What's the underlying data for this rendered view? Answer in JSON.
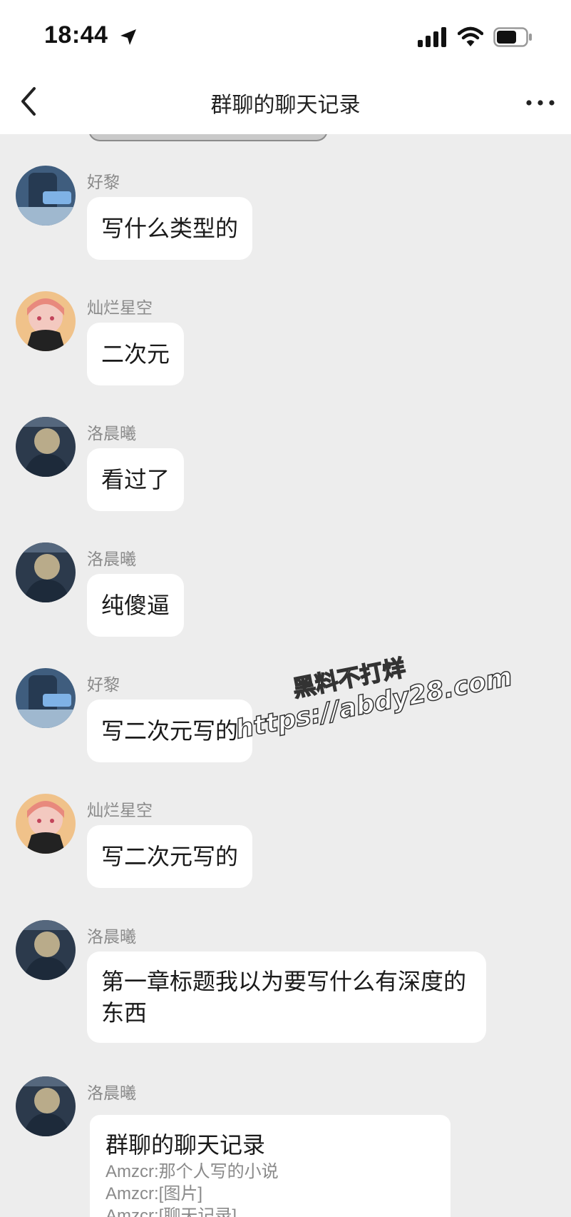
{
  "status": {
    "time": "18:44"
  },
  "nav": {
    "title": "群聊的聊天记录"
  },
  "messages": [
    {
      "sender": "好黎",
      "text": "写什么类型的",
      "avatar": "avatar-blue"
    },
    {
      "sender": "灿烂星空",
      "text": "二次元",
      "avatar": "avatar-pink"
    },
    {
      "sender": "洛晨曦",
      "text": "看过了",
      "avatar": "avatar-dark"
    },
    {
      "sender": "洛晨曦",
      "text": "纯傻逼",
      "avatar": "avatar-dark"
    },
    {
      "sender": "好黎",
      "text": "写二次元写的",
      "avatar": "avatar-blue"
    },
    {
      "sender": "灿烂星空",
      "text": "写二次元写的",
      "avatar": "avatar-pink"
    },
    {
      "sender": "洛晨曦",
      "text": "第一章标题我以为要写什么有深度的东西",
      "avatar": "avatar-dark"
    },
    {
      "sender": "洛晨曦",
      "avatar": "avatar-dark"
    }
  ],
  "record_card": {
    "title": "群聊的聊天记录",
    "lines": [
      "Amzcr:那个人写的小说",
      "Amzcr:[图片]",
      "Amzcr:[聊天记录]"
    ]
  },
  "watermark": {
    "line1": "黑料不打烊",
    "line2": "https://abdy28.com"
  },
  "colors": {
    "background": "#ededed",
    "bubble": "#ffffff",
    "bar": "#ffffff",
    "sender_text": "#8a8a8a"
  }
}
